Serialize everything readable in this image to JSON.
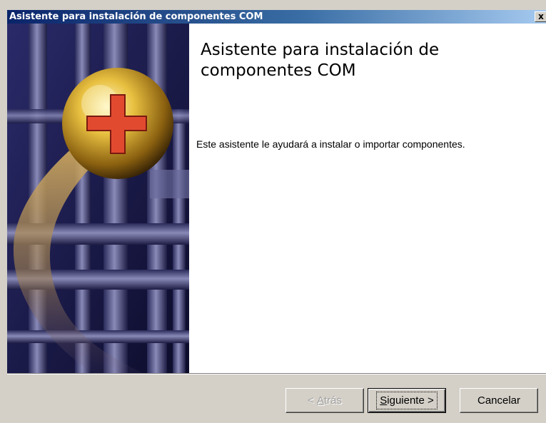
{
  "window": {
    "title": "Asistente para instalación de componentes COM",
    "close_label": "x"
  },
  "content": {
    "heading": "Asistente para instalación de componentes COM",
    "description": "Este asistente le ayudará a instalar o importar componentes."
  },
  "buttons": {
    "back": {
      "prefix": "< ",
      "accel": "A",
      "rest": "trás",
      "disabled": true
    },
    "next": {
      "accel": "S",
      "rest": "iguiente >",
      "default": true
    },
    "cancel": {
      "label": "Cancelar"
    }
  },
  "colors": {
    "titlebar_start": "#0a246a",
    "titlebar_end": "#a6caf0",
    "dialog_face": "#d4d0c8",
    "banner_bg": "#14143e"
  },
  "icons": {
    "banner": "gold-plus-orb-over-pipes",
    "close": "close-icon"
  }
}
